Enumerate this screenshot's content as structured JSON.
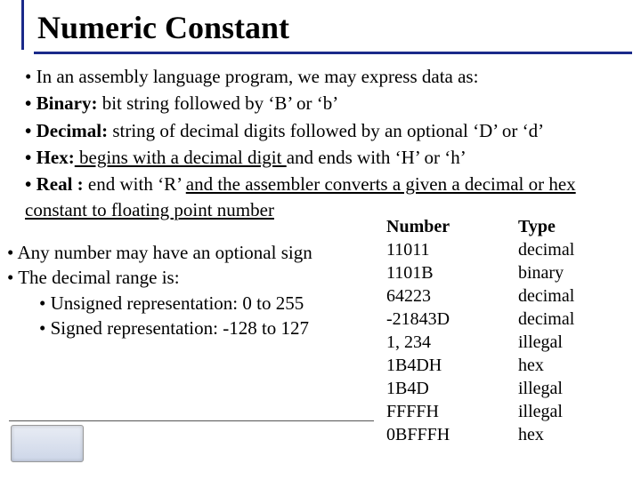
{
  "title": "Numeric Constant",
  "bullets_top": {
    "l1_pre": "• In an assembly language program, we may express data as:",
    "l2_label": "• Binary:",
    "l2_rest": " bit string followed by ‘B’ or ‘b’",
    "l3_label": "• Decimal:",
    "l3_rest": " string of decimal digits followed by an optional ‘D’ or ‘d’",
    "l4_label": "• Hex:",
    "l4_u": " begins with a decimal digit ",
    "l4_rest": "and ends with ‘H’ or ‘h’",
    "l5_label": "• Real :",
    "l5_rest_a": " end with ‘R’  ",
    "l5_u": "and the assembler converts a given a decimal or hex constant to floating point number"
  },
  "bullets_left": {
    "l1": "• Any number may have an optional sign",
    "l2": "• The decimal range is:",
    "l3": "• Unsigned representation: 0 to 255",
    "l4": "• Signed representation: -128 to 127"
  },
  "table": {
    "head_num": "Number",
    "head_type": "Type",
    "rows": [
      {
        "num": "11011",
        "type": "decimal"
      },
      {
        "num": "1101B",
        "type": "binary"
      },
      {
        "num": "64223",
        "type": "decimal"
      },
      {
        "num": "-21843D",
        "type": "decimal"
      },
      {
        "num": "1, 234",
        "type": "illegal"
      },
      {
        "num": "1B4DH",
        "type": "hex"
      },
      {
        "num": "1B4D",
        "type": "illegal"
      },
      {
        "num": "FFFFH",
        "type": "illegal"
      },
      {
        "num": "0BFFFH",
        "type": "hex"
      }
    ]
  }
}
